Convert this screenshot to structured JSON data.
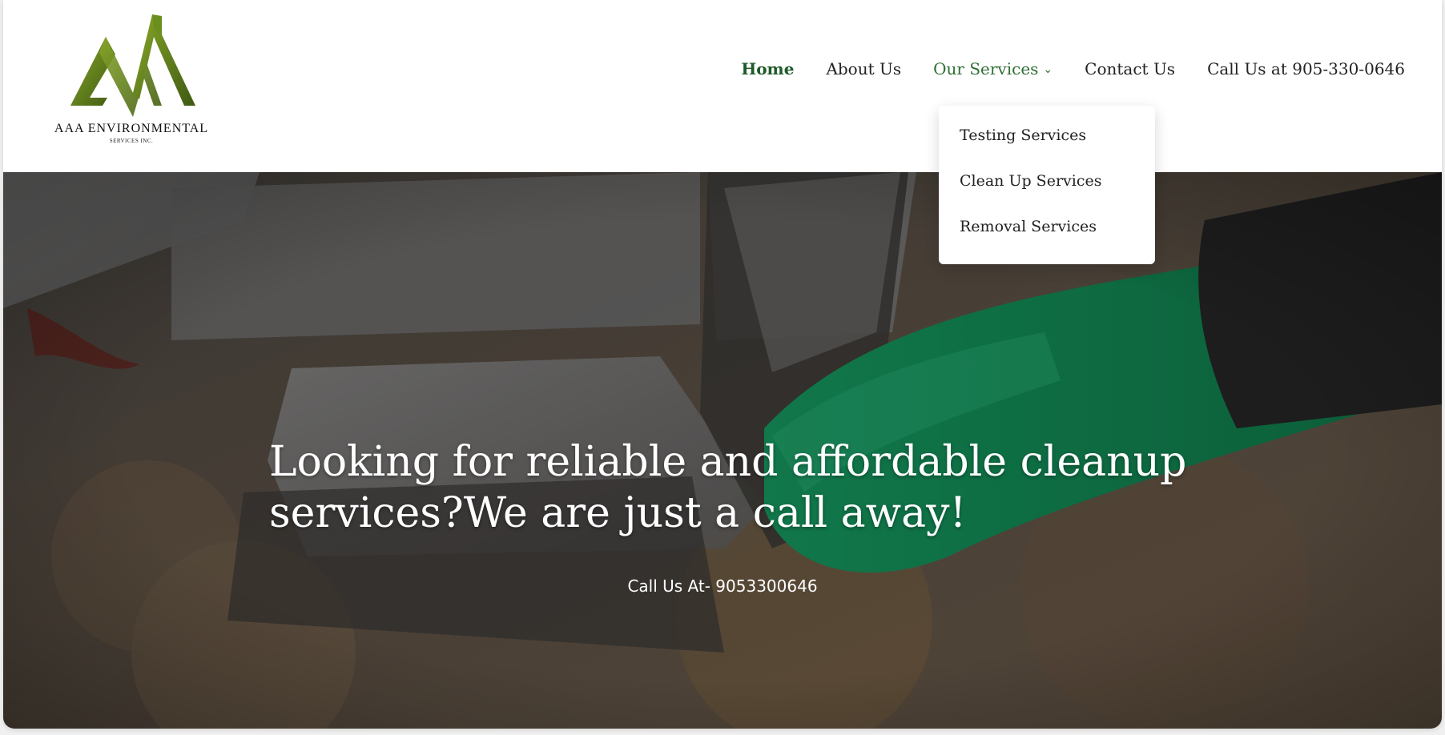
{
  "logo": {
    "name": "AAA ENVIRONMENTAL",
    "sub": "SERVICES INC.",
    "icon": "mountain-logo-icon"
  },
  "nav": {
    "home": "Home",
    "about": "About Us",
    "services": "Our Services",
    "contact": "Contact Us",
    "call": "Call Us at 905-330-0646"
  },
  "dropdown": {
    "items": [
      "Testing Services",
      "Clean Up Services",
      "Removal Services"
    ]
  },
  "hero": {
    "title": "Looking for reliable and affordable cleanup services?We are just a call away!",
    "subtitle": "Call Us At- 9053300646"
  },
  "colors": {
    "active_nav": "#1f5a2a",
    "services_nav": "#2f6e34",
    "logo_green": "#5a7d1a",
    "glove": "#1a8a5a"
  }
}
